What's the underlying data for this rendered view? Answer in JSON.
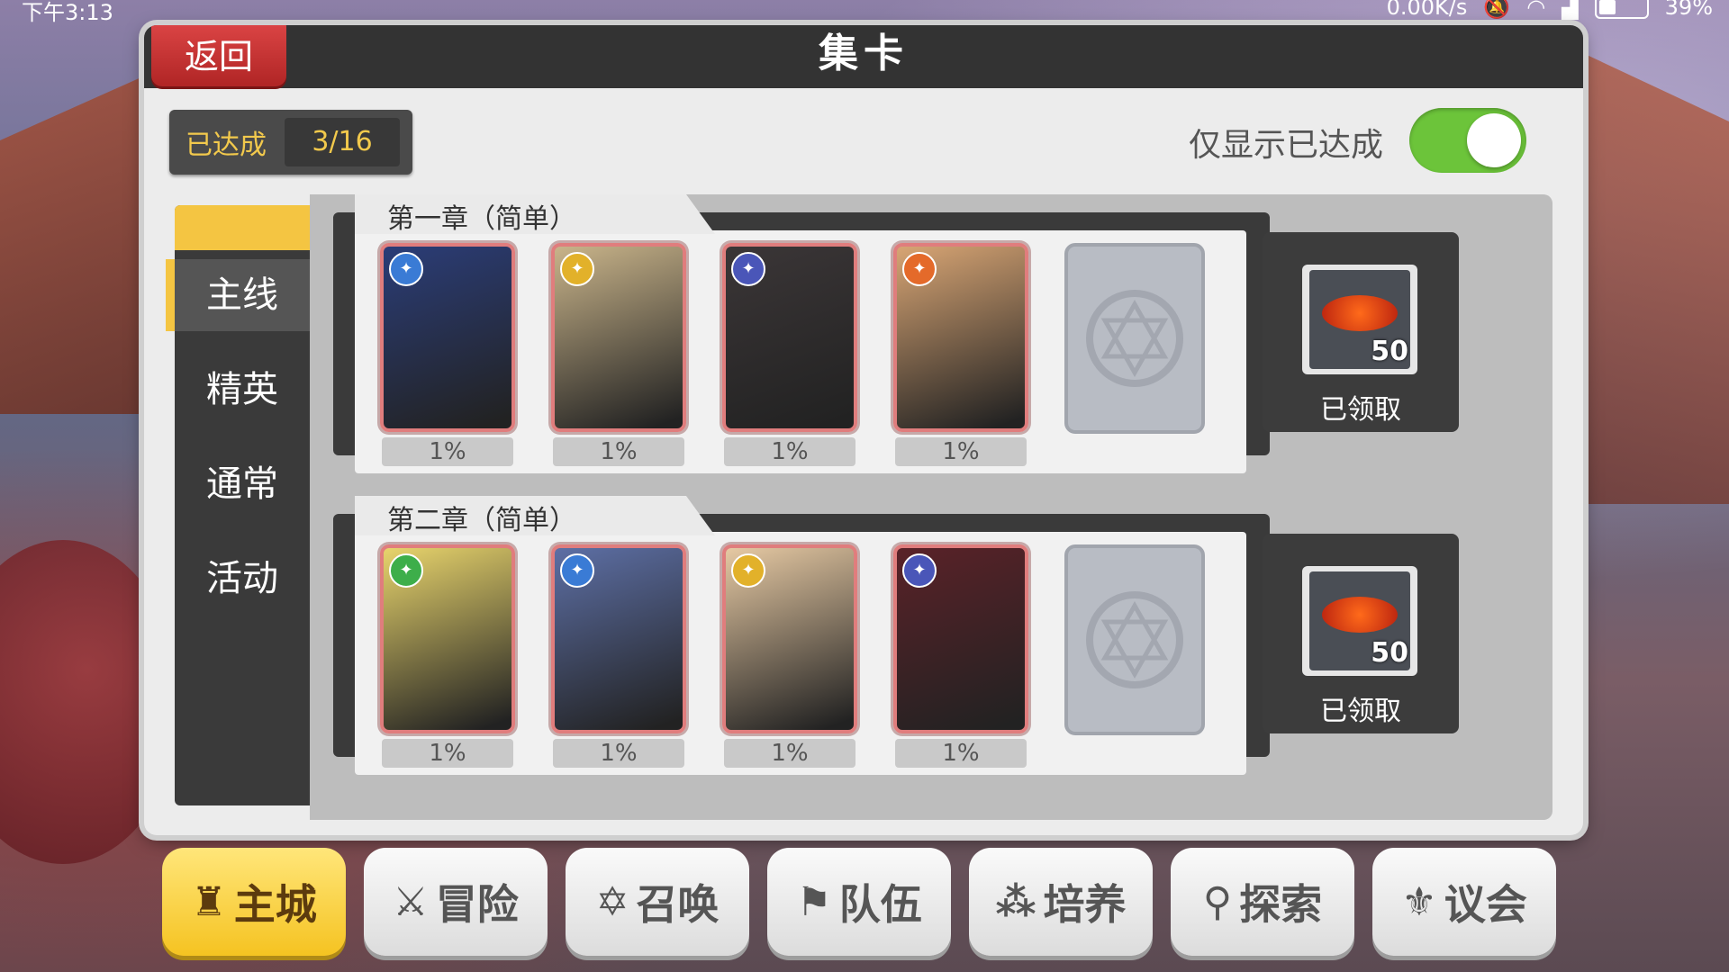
{
  "status_bar": {
    "time": "下午3:13",
    "net_speed": "0.00K/s",
    "battery": "39%"
  },
  "header": {
    "title": "集卡",
    "back_label": "返回"
  },
  "progress": {
    "label": "已达成",
    "value": "3/16"
  },
  "filter": {
    "label": "仅显示已达成",
    "enabled": true
  },
  "tabs": [
    {
      "label": "主线",
      "active": true
    },
    {
      "label": "精英",
      "active": false
    },
    {
      "label": "通常",
      "active": false
    },
    {
      "label": "活动",
      "active": false
    }
  ],
  "chapters": [
    {
      "title": "第一章（简单）",
      "cards": [
        {
          "percent": "1%",
          "badge_color": "#3a7bd5",
          "art": "#2b3d78"
        },
        {
          "percent": "1%",
          "badge_color": "#e2b12a",
          "art": "#c9b48a"
        },
        {
          "percent": "1%",
          "badge_color": "#4a56b8",
          "art": "#3b3637"
        },
        {
          "percent": "1%",
          "badge_color": "#e46a2a",
          "art": "#d8a574"
        }
      ],
      "reward": {
        "count": "50",
        "status": "已领取"
      }
    },
    {
      "title": "第二章（简单）",
      "cards": [
        {
          "percent": "1%",
          "badge_color": "#3dae4a",
          "art": "#e8d46c"
        },
        {
          "percent": "1%",
          "badge_color": "#3a7bd5",
          "art": "#5d6fa5"
        },
        {
          "percent": "1%",
          "badge_color": "#e2b12a",
          "art": "#e6c9a3"
        },
        {
          "percent": "1%",
          "badge_color": "#4a56b8",
          "art": "#5a2228"
        }
      ],
      "reward": {
        "count": "50",
        "status": "已领取"
      }
    }
  ],
  "bottom_nav": [
    {
      "label": "主城",
      "icon": "castle-icon",
      "glyph": "♜",
      "active": true
    },
    {
      "label": "冒险",
      "icon": "crossed-swords-icon",
      "glyph": "⚔",
      "active": false
    },
    {
      "label": "召唤",
      "icon": "hexagram-icon",
      "glyph": "✡",
      "active": false
    },
    {
      "label": "队伍",
      "icon": "flag-icon",
      "glyph": "⚑",
      "active": false
    },
    {
      "label": "培养",
      "icon": "circles-icon",
      "glyph": "⁂",
      "active": false
    },
    {
      "label": "探索",
      "icon": "explore-icon",
      "glyph": "⚲",
      "active": false
    },
    {
      "label": "议会",
      "icon": "council-icon",
      "glyph": "⚜",
      "active": false
    }
  ],
  "colors": {
    "accent": "#f4c542",
    "toggle_on": "#6cc43a",
    "back_button": "#d33a3a"
  }
}
